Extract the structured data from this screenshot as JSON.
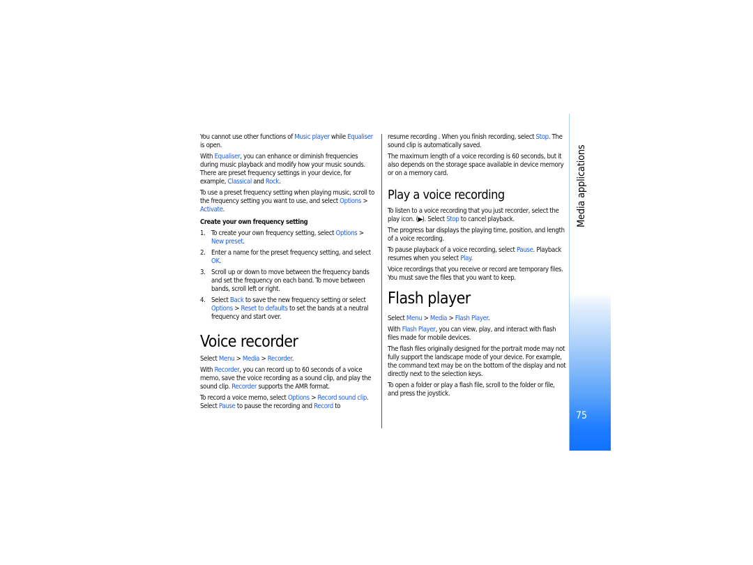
{
  "section_title": "Media applications",
  "page_number": "75",
  "colors": {
    "link": "#1a5cf0",
    "tab_gradient_bottom": "#0f72ff",
    "side_line": "#a9d3f5"
  },
  "col1": {
    "p1": {
      "t1": "You cannot use other functions of ",
      "l1": "Music player",
      "t2": " while ",
      "l2": "Equaliser",
      "t3": " is open."
    },
    "p2": {
      "t1": "With ",
      "l1": "Equaliser",
      "t2": ", you can enhance or diminish frequencies during music playback and modify how your music sounds. There are preset frequency settings in your device, for example, ",
      "l2": "Classical",
      "t3": " and ",
      "l3": "Rock",
      "t4": "."
    },
    "p3": {
      "t1": "To use a preset frequency setting when playing music, scroll to the frequency setting you want to use, and select ",
      "l1": "Options",
      "sep": " > ",
      "l2": "Activate",
      "t2": "."
    },
    "subheading": "Create your own frequency setting",
    "steps": [
      {
        "num": "1.",
        "t1": "To create your own frequency setting, select ",
        "l1": "Options",
        "sep": " > ",
        "l2": "New preset",
        "t2": "."
      },
      {
        "num": "2.",
        "t1": "Enter a name for the preset frequency setting, and select ",
        "l1": "OK",
        "t2": "."
      },
      {
        "num": "3.",
        "t1": "Scroll up or down to move between the frequency bands and set the frequency on each band. To move between bands, scroll left or right."
      },
      {
        "num": "4.",
        "t1": "Select ",
        "l1": "Back",
        "t2": " to save the new frequency setting or select ",
        "l2": "Options",
        "sep": " > ",
        "l3": "Reset to defaults",
        "t3": " to set the bands at a neutral frequency and start over."
      }
    ],
    "voice_recorder": {
      "heading": "Voice recorder",
      "p1": {
        "t1": "Select ",
        "l1": "Menu",
        "sep1": " > ",
        "l2": "Media",
        "sep2": " > ",
        "l3": "Recorder",
        "t2": "."
      },
      "p2": {
        "t1": "With ",
        "l1": "Recorder",
        "t2": ", you can record up to 60 seconds of a voice memo, save the voice recording as a sound clip, and play the sound clip. ",
        "l2": "Recorder",
        "t3": " supports the AMR format."
      },
      "p3": {
        "t1": "To record a voice memo, select ",
        "l1": "Options",
        "sep": " > ",
        "l2": "Record sound clip",
        "t2": ". Select ",
        "l3": "Pause",
        "t3": " to pause the recording and ",
        "l4": "Record",
        "t4": " to"
      }
    }
  },
  "col2": {
    "p1": {
      "t1": "resume recording . When you finish recording, select ",
      "l1": "Stop",
      "t2": ". The sound clip is automatically saved."
    },
    "p2": {
      "t1": "The maximum length of a voice recording is 60 seconds, but it also depends on the storage space available in device memory or on a memory card."
    },
    "play": {
      "heading": "Play a voice recording",
      "p1": {
        "t1": "To listen to a voice recording that you just recorder, select the play icon. (",
        "icon": "play-icon",
        "glyph": "▶",
        "t2": "). Select ",
        "l1": "Stop",
        "t3": " to cancel playback."
      },
      "p2": {
        "t1": "The progress bar displays the playing time, position, and length of a voice recording."
      },
      "p3": {
        "t1": "To pause playback of a voice recording, select ",
        "l1": "Pause",
        "t2": ". Playback resumes when you select ",
        "l2": "Play",
        "t3": "."
      },
      "p4": {
        "t1": "Voice recordings that you receive or record are temporary files. You must save the files that you want to keep."
      }
    },
    "flash": {
      "heading": "Flash player",
      "p1": {
        "t1": "Select ",
        "l1": "Menu",
        "sep1": " > ",
        "l2": "Media",
        "sep2": " > ",
        "l3": "Flash Player",
        "t2": "."
      },
      "p2": {
        "t1": "With ",
        "l1": "Flash Player",
        "t2": ", you can view, play, and interact with flash files made for mobile devices."
      },
      "p3": {
        "t1": "The flash files originally designed for the portrait mode may not fully support the landscape mode of your device. For example, the command text may be on the bottom of the display and not directly next to the selection keys."
      },
      "p4": {
        "t1": "To open a folder or play a flash file, scroll to the folder or file, and press the joystick."
      }
    }
  }
}
